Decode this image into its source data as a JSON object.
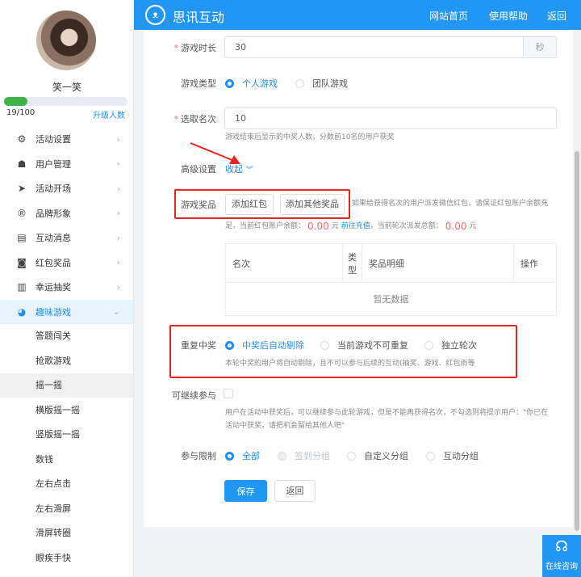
{
  "sidebar": {
    "user_name": "笑一笑",
    "progress": {
      "current": 19,
      "max": 100,
      "text": "19/100"
    },
    "upgrade_link": "升级人数",
    "menu": [
      {
        "label": "活动设置",
        "icon": "gear-icon"
      },
      {
        "label": "用户管理",
        "icon": "user-icon"
      },
      {
        "label": "活动开场",
        "icon": "paper-plane-icon"
      },
      {
        "label": "品牌形象",
        "icon": "registered-icon"
      },
      {
        "label": "互动消息",
        "icon": "message-icon"
      },
      {
        "label": "红包奖品",
        "icon": "red-packet-icon"
      },
      {
        "label": "幸运抽奖",
        "icon": "lottery-icon"
      },
      {
        "label": "趣味游戏",
        "icon": "game-icon"
      }
    ],
    "submenu": [
      "答题闯关",
      "抢歌游戏",
      "摇一摇",
      "横版摇一摇",
      "竖版摇一摇",
      "数钱",
      "左右点击",
      "左右滑屏",
      "滑屏转圈",
      "眼疾手快"
    ]
  },
  "header": {
    "brand": "思讯互动",
    "nav": [
      "网站首页",
      "使用帮助",
      "返回"
    ]
  },
  "form": {
    "duration": {
      "label": "游戏时长",
      "value": "30",
      "unit": "秒"
    },
    "game_type": {
      "label": "游戏类型",
      "options": [
        "个人游戏",
        "团队游戏"
      ]
    },
    "ranks": {
      "label": "选取名次",
      "value": "10",
      "hint": "游戏结束后显示的中奖人数，分数前10名的用户获奖"
    },
    "advanced": {
      "label": "高级设置",
      "toggle": "收起"
    },
    "prizes": {
      "label": "游戏奖品",
      "add_red_packet": "添加红包",
      "add_other": "添加其他奖品",
      "note1": "如果给获得名次的用户派发微信红包，请保证红包账户余额充",
      "note2a": "足，当前红包账户余额：",
      "balance": "0.00",
      "yuan": "元",
      "recharge": "前往充值",
      "note2b": "，当前轮次派发总额：",
      "total": "0.00",
      "table": {
        "headers": [
          "名次",
          "类型",
          "奖品明细",
          "操作"
        ],
        "empty": "暂无数据"
      }
    },
    "repeat": {
      "label": "重复中奖",
      "options": [
        "中奖后自动剔除",
        "当前游戏不可重复",
        "独立轮次"
      ],
      "hint": "本轮中奖的用户将自动剔除，且不可以参与后续的互动(抽奖、游戏、红包雨等"
    },
    "continue": {
      "label": "可继续参与",
      "hint1": "用户在活动中获奖后，可以继续参与此轮游戏，但是不能再获得名次，不勾选则将提示用户：\"你已在",
      "hint2": "活动中获奖，请把机会留给其他人吧\""
    },
    "limit": {
      "label": "参与限制",
      "options": [
        "全部",
        "签到分组",
        "自定义分组",
        "互动分组"
      ]
    },
    "save": "保存",
    "back": "返回"
  },
  "consult": "在线咨询"
}
